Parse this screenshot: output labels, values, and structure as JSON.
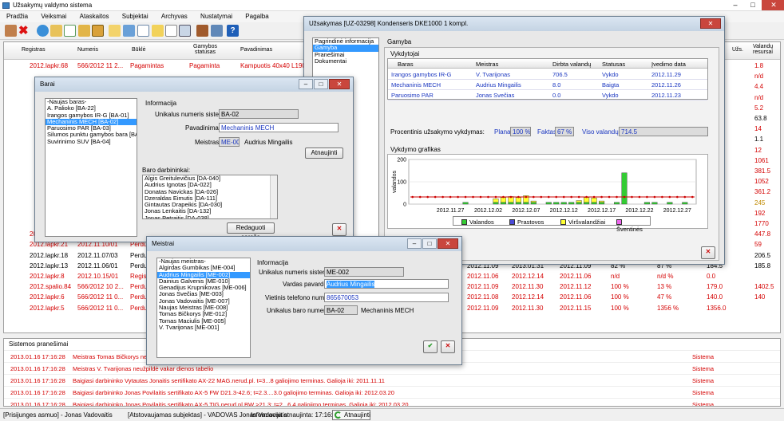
{
  "app": {
    "title": "Užsakymų valdymo sistema"
  },
  "menu": [
    "Pradžia",
    "Veiksmai",
    "Ataskaitos",
    "Subjektai",
    "Archyvas",
    "Nustatymai",
    "Pagalba"
  ],
  "toolbar_icons": [
    "user-delete-icon",
    "close-red-icon",
    "refresh-icon",
    "folder-icon",
    "add-document-icon",
    "edit-icon",
    "report-icon",
    "download-icon",
    "import-icon",
    "grid-icon",
    "email-icon",
    "print-preview-icon",
    "print-icon",
    "tools-icon",
    "users-icon",
    "help-icon"
  ],
  "grid": {
    "columns": [
      "Registras",
      "Numeris",
      "Būklė",
      "Gamybos statusas",
      "Pavadinimas",
      "Užs.",
      "Valandų resursai"
    ],
    "rows": [
      {
        "registras": "2012.lapkr.68",
        "numeris": "566/2012 11 2...",
        "bukle": "Pagamintas",
        "gamyba": "Pagaminta",
        "pavadinimas": "Kampuotis 40x40 L1900",
        "val": "1.8",
        "color": "red"
      },
      {
        "registras": "",
        "numeris": "",
        "bukle": "",
        "gamyba": "",
        "pavadinimas": "",
        "val": "n/d",
        "color": "red"
      },
      {
        "registras": "",
        "numeris": "",
        "bukle": "",
        "gamyba": "",
        "pavadinimas": "",
        "val": "4.4",
        "color": "red"
      },
      {
        "registras": "",
        "numeris": "",
        "bukle": "",
        "gamyba": "",
        "pavadinimas": "",
        "val": "n/d",
        "color": "red"
      },
      {
        "registras": "",
        "numeris": "",
        "bukle": "",
        "gamyba": "",
        "pavadinimas": "",
        "val": "5.2",
        "color": "red"
      },
      {
        "registras": "",
        "numeris": "",
        "bukle": "",
        "gamyba": "",
        "pavadinimas": "",
        "val": "63.8",
        "color": "dk"
      },
      {
        "registras": "",
        "numeris": "",
        "bukle": "",
        "gamyba": "",
        "pavadinimas": "",
        "val": "14",
        "color": "red"
      },
      {
        "registras": "",
        "numeris": "",
        "bukle": "",
        "gamyba": "",
        "pavadinimas": "",
        "val": "1.1",
        "color": "dk"
      },
      {
        "registras": "",
        "numeris": "",
        "bukle": "",
        "gamyba": "",
        "pavadinimas": "",
        "val": "12",
        "color": "red"
      },
      {
        "registras": "",
        "numeris": "",
        "bukle": "",
        "gamyba": "",
        "pavadinimas": "",
        "val": "1061",
        "color": "red"
      },
      {
        "registras": "",
        "numeris": "",
        "bukle": "",
        "gamyba": "",
        "pavadinimas": "",
        "val": "381.5",
        "color": "red"
      },
      {
        "registras": "",
        "numeris": "",
        "bukle": "",
        "gamyba": "",
        "pavadinimas": "",
        "val": "1052",
        "color": "red"
      },
      {
        "registras": "",
        "numeris": "",
        "bukle": "",
        "gamyba": "",
        "pavadinimas": "",
        "val": "361.2",
        "color": "red"
      },
      {
        "registras": "",
        "numeris": "",
        "bukle": "",
        "gamyba": "",
        "pavadinimas": "",
        "val": "245",
        "color": "orange"
      },
      {
        "registras": "",
        "numeris": "",
        "bukle": "",
        "gamyba": "",
        "pavadinimas": "",
        "val": "192",
        "color": "red"
      },
      {
        "registras": "",
        "numeris": "",
        "bukle": "",
        "gamyba": "",
        "pavadinimas": "",
        "val": "1770",
        "color": "red"
      },
      {
        "registras": "2012.rugpj.45",
        "numeris": "566/2012 11 0...",
        "bukle": "Perduota",
        "gamyba": "",
        "pavadinimas": "",
        "val": "447.8",
        "color": "red"
      },
      {
        "registras": "2012.lapkr.21",
        "numeris": "2012.11.10/01",
        "bukle": "Perduota",
        "gamyba": "",
        "pavadinimas": "",
        "val": "59",
        "color": "red"
      },
      {
        "registras": "2012.lapkr.18",
        "numeris": "2012.11.07/03",
        "bukle": "Perduota",
        "gamyba": "",
        "pavadinimas": "",
        "val": "206.5",
        "color": "dk"
      },
      {
        "registras": "2012.lapkr.13",
        "numeris": "2012.11.06/01",
        "bukle": "Perduota",
        "gamyba": "",
        "pavadinimas": "",
        "val": "185.8",
        "color": "dk"
      },
      {
        "registras": "2012.lapkr.8",
        "numeris": "2012.10.15/01",
        "bukle": "Registr",
        "gamyba": "",
        "pavadinimas": "",
        "val": "",
        "color": "red"
      },
      {
        "registras": "2012.spalio.84",
        "numeris": "566/2012 10 2...",
        "bukle": "Perduota",
        "gamyba": "",
        "pavadinimas": "",
        "val": "1402.5",
        "color": "red"
      },
      {
        "registras": "2012.lapkr.6",
        "numeris": "566/2012 11 0...",
        "bukle": "Perduota",
        "gamyba": "",
        "pavadinimas": "",
        "val": "140",
        "color": "red"
      },
      {
        "registras": "2012.lapkr.5",
        "numeris": "566/2012 11 0...",
        "bukle": "Perduota",
        "gamyba": "",
        "pavadinimas": "",
        "val": "",
        "color": "red"
      }
    ],
    "extra_rows": [
      {
        "d1": "2012.11.09",
        "d2": "2012.12.14",
        "d3": "2012.11.12",
        "p1": "100 %",
        "p2": "87 %",
        "v1": "180.1",
        "color": "dk"
      },
      {
        "d1": "2012.11.09",
        "d2": "2013.01.31",
        "d3": "2012.11.09",
        "p1": "82 %",
        "p2": "87 %",
        "v1": "184.5",
        "color": "dk"
      },
      {
        "d1": "2012.11.06",
        "d2": "2012.12.14",
        "d3": "2012.11.06",
        "p1": "n/d",
        "p2": "n/d %",
        "v1": "0.0",
        "color": "red"
      },
      {
        "d1": "2012.11.09",
        "d2": "2012.11.30",
        "d3": "2012.11.12",
        "p1": "100 %",
        "p2": "13 %",
        "v1": "179.0",
        "color": "red"
      },
      {
        "d1": "2012.11.08",
        "d2": "2012.12.14",
        "d3": "2012.11.06",
        "p1": "100 %",
        "p2": "47 %",
        "v1": "140.0",
        "color": "red"
      },
      {
        "d1": "2012.11.09",
        "d2": "2012.11.30",
        "d3": "2012.11.15",
        "p1": "100 %",
        "p2": "1356 %",
        "v1": "1356.0",
        "color": "red"
      }
    ]
  },
  "messages": {
    "caption": "Sistemos pranešimai",
    "items": [
      {
        "time": "2013.01.16 17:16:28",
        "text": "Meistras Tomas Bičkorys neužpildė vakar dienos tabelio",
        "src": "Sistema"
      },
      {
        "time": "2013.01.16 17:16:28",
        "text": "Meistras V. Tvarijonas neužpildė vakar dienos tabelio",
        "src": "Sistema"
      },
      {
        "time": "2013.01.16 17:16:28",
        "text": "Baigiasi darbininko Vytautas Jonaitis sertifikato AX-22 MAG.nerud.pl. t=3...8 galiojimo terminas. Galioja iki: 2011.11.11",
        "src": "Sistema"
      },
      {
        "time": "2013.01.16 17:16:28",
        "text": "Baigiasi darbininko Jonas Povilaitis sertifikato AX-5 FW D21.3-42.6; t=2.3....3.0 galiojimo terminas. Galioja iki: 2012.03.20",
        "src": "Sistema"
      },
      {
        "time": "2013.01.16 17:16:28",
        "text": "Baigiasi darbininko Jonas Povilaitis sertifikato AX-5 TIG nerud.pl.BW >21.3; t=2...6.4 galiojimo terminas. Galioja iki: 2012.03.20",
        "src": "Sistema"
      }
    ]
  },
  "status": {
    "user": "[Prisijunges asmuo] - Jonas Vadovaitis",
    "subject": "[Atstovaujamas subjektas] - VADOVAS Jonas Vadovaitis",
    "updated": "Informacija atnaujinta: 17:16:28",
    "refresh": "Atnaujinti"
  },
  "barai": {
    "title": "Barai",
    "list": [
      "-Naujas baras-",
      "A. Paliokо [BA-22]",
      "Irangos gamybos IR-G [BA-01]",
      "Mechaninis MECH [BA-02]",
      "Paruosimo PAR [BA-03]",
      "Silumos punktu gamybos bara [BA-10]",
      "Suvirinimo SUV [BA-04]"
    ],
    "selected_index": 3,
    "info_label": "Informacija",
    "id_label": "Unikalus numeris sistemoje:",
    "id_value": "BA-02",
    "name_label": "Pavadinimas:",
    "name_value": "Mechaninis MECH",
    "meistras_label": "Meistras:",
    "meistras_code": "ME-002",
    "meistras_name": "Audrius Mingailis",
    "refresh_btn": "Atnaujinti",
    "workers_label": "Baro darbininkai:",
    "workers": [
      "Algis Greitulevičius [DA-040]",
      "Audrius Ignotas [DA-022]",
      "Donatas Navickas [DA-026]",
      "Dzeraldas Eimutis [DA-111]",
      "Gintautas Drapeikis [DA-030]",
      "Jonas Lenkaitis [DA-132]",
      "Jonas Petraitis [DA-038]"
    ],
    "edit_btn": "Redaguoti sąrašą"
  },
  "meistrai": {
    "title": "Meistrai",
    "list": [
      "-Naujas meistras-",
      "Algirdas Gumbikas [ME-004]",
      "Audrius Mingailis [ME-002]",
      "Dainius Galvenis [ME-010]",
      "Genadijus Krupnikovas [ME-006]",
      "Jonas Svečias [ME-003]",
      "Jonas Vadovaitis [ME-007]",
      "Naujas Meistras [ME-008]",
      "Tomas Bičkorys [ME-012]",
      "Tomas Maciulis [ME-005]",
      "V. Tvarijonas [ME-001]"
    ],
    "selected_index": 2,
    "info_label": "Informacija",
    "id_label": "Unikalus numeris sistemoje:",
    "id_value": "ME-002",
    "name_label": "Vardas pavardė:",
    "name_value": "Audrius Mingailis",
    "phone_label": "Vietinis telefono numeris:",
    "phone_value": "865670053",
    "baro_label": "Unikalus baro numeris:",
    "baro_value": "BA-02",
    "baro_name": "Mechaninis MECH"
  },
  "order": {
    "title": "Užsakymas [UZ-03298] Kondensеris DKE1000  1 kompl.",
    "nav": [
      "Pagrindinė informacija",
      "Gamyba",
      "Pranešimai",
      "Dokumentai"
    ],
    "nav_selected": 1,
    "section": "Gamyba",
    "executors_label": "Vykdytojai",
    "table_headers": [
      "Baras",
      "Meistras",
      "Dirbta valandų",
      "Statusas",
      "Įvedimo data"
    ],
    "table_rows": [
      {
        "baras": "Irangos gamybos IR-G",
        "meistras": "V. Tvarijonas",
        "val": "706.5",
        "status": "Vykdо",
        "data": "2012.11.29"
      },
      {
        "baras": "Mechaninis MECH",
        "meistras": "Audrius Mingailis",
        "val": "8.0",
        "status": "Baigta",
        "data": "2012.11.26"
      },
      {
        "baras": "Paruosimo PAR",
        "meistras": "Jonas Svečias",
        "val": "0.0",
        "status": "Vykdо",
        "data": "2012.11.23"
      }
    ],
    "progress_label": "Procentinis užsakymo vykdymas:",
    "planas_label": "Planas",
    "planas_value": "100 %",
    "faktas_label": "Faktas",
    "faktas_value": "67 %",
    "viso_label": "Viso valandų:",
    "viso_value": "714.5",
    "chart_caption": "Vykdymo grafikas"
  },
  "chart_data": {
    "type": "bar",
    "ylabel": "valandos",
    "ylim": [
      0,
      200
    ],
    "yticks": [
      0,
      100,
      200
    ],
    "xticks": [
      "2012.11.27",
      "2012.12.02",
      "2012.12.07",
      "2012.12.12",
      "2012.12.17",
      "2012.12.22",
      "2012.12.27"
    ],
    "legend": [
      "Valandos",
      "Prastovos",
      "Viršvalandžiai",
      "Šventinės"
    ],
    "colors": {
      "Valandos": "#33cc33",
      "Prastovos": "#4a4ad8",
      "Viršvalandžiai": "#ffff33",
      "Šventinės": "#ee66ee",
      "line": "#cc0000"
    },
    "plan_level": 8,
    "series": [
      {
        "name": "Valandos",
        "values": [
          0,
          0,
          0,
          0,
          0,
          0,
          0,
          0,
          0,
          0,
          0,
          0,
          0,
          0,
          0,
          0,
          0,
          0,
          0,
          0,
          0,
          0,
          0,
          0,
          0,
          0,
          0,
          0,
          0,
          0,
          0,
          0,
          0,
          0,
          0,
          0,
          0,
          0,
          0,
          0,
          0,
          0,
          0,
          0,
          0,
          0,
          0,
          0,
          0,
          0,
          0,
          0,
          0,
          0,
          0,
          0,
          0,
          0,
          0,
          0,
          0,
          0,
          0,
          0,
          0,
          0,
          0,
          0,
          0,
          0,
          0,
          0,
          0,
          0,
          0,
          0,
          0,
          0,
          0,
          0,
          0,
          0,
          0,
          0,
          0,
          0
        ]
      },
      {
        "name": "Viršvalandžiai",
        "values": []
      }
    ],
    "bars": [
      {
        "day": "2012.11.29",
        "v": 8,
        "o": 0
      },
      {
        "day": "2012.12.03",
        "v": 8,
        "o": 0
      },
      {
        "day": "2012.12.04",
        "v": 8,
        "o": 0
      },
      {
        "day": "2012.12.05",
        "v": 8,
        "o": 0
      },
      {
        "day": "2012.12.06",
        "v": 8,
        "o": 0
      },
      {
        "day": "2012.12.07",
        "v": 8,
        "o": 0
      },
      {
        "day": "2012.12.04b",
        "v": 8,
        "o": 0
      }
    ]
  }
}
